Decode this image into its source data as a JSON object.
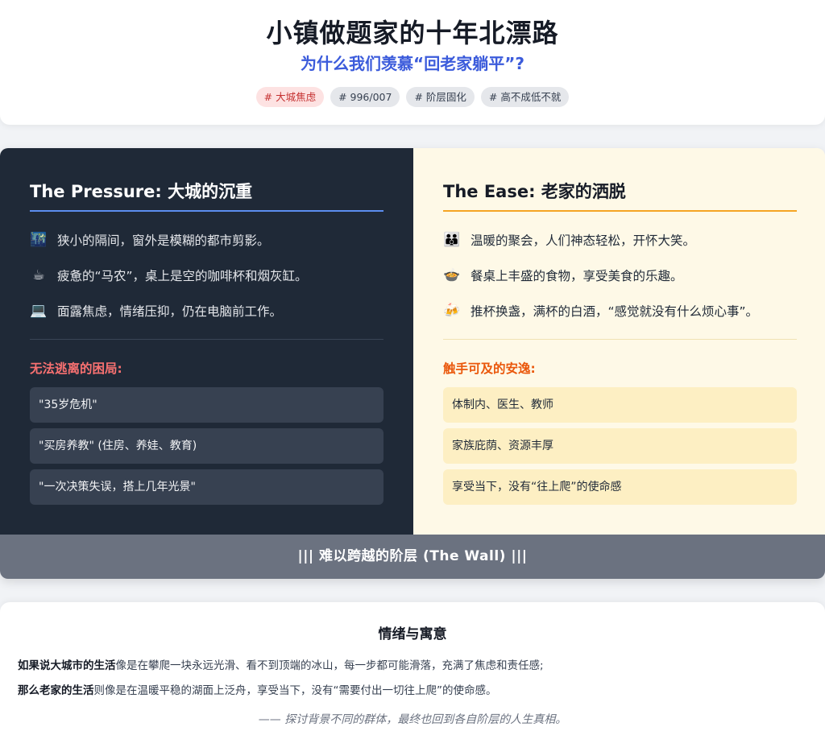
{
  "header": {
    "title": "小镇做题家的十年北漂路",
    "subtitle": "为什么我们羡慕“回老家躺平”?",
    "tags": [
      {
        "label": "# 大城焦虑",
        "highlight": true
      },
      {
        "label": "# 996/007",
        "highlight": false
      },
      {
        "label": "# 阶层固化",
        "highlight": false
      },
      {
        "label": "# 高不成低不就",
        "highlight": false
      }
    ]
  },
  "pressure": {
    "title": "The Pressure: 大城的沉重",
    "items": [
      {
        "icon": "🌃",
        "icon_name": "city-night-icon",
        "text": "狭小的隔间，窗外是模糊的都市剪影。"
      },
      {
        "icon": "☕",
        "icon_name": "coffee-icon",
        "text": "疲惫的“马农”，桌上是空的咖啡杯和烟灰缸。"
      },
      {
        "icon": "💻",
        "icon_name": "laptop-icon",
        "text": "面露焦虑，情绪压抑，仍在电脑前工作。"
      }
    ],
    "section_label": "无法逃离的困局:",
    "boxes": [
      "\"35岁危机\"",
      "\"买房养教\" (住房、养娃、教育)",
      "\"一次决策失误，搭上几年光景\""
    ]
  },
  "ease": {
    "title": "The Ease: 老家的洒脱",
    "items": [
      {
        "icon": "👪",
        "icon_name": "family-icon",
        "text": "温暖的聚会，人们神态轻松，开怀大笑。"
      },
      {
        "icon": "🍲",
        "icon_name": "food-bowl-icon",
        "text": "餐桌上丰盛的食物，享受美食的乐趣。"
      },
      {
        "icon": "🍻",
        "icon_name": "toast-drinks-icon",
        "text": "推杯换盏，满杯的白酒，“感觉就没有什么烦心事”。"
      }
    ],
    "section_label": "触手可及的安逸:",
    "boxes": [
      "体制内、医生、教师",
      "家族庇荫、资源丰厚",
      "享受当下，没有“往上爬”的使命感"
    ]
  },
  "wall": {
    "label": "||| 难以跨越的阶层 (The Wall) |||"
  },
  "footer": {
    "title": "情绪与寓意",
    "line1_bold": "如果说大城市的生活",
    "line1_rest": "像是在攀爬一块永远光滑、看不到顶端的冰山，每一步都可能滑落，充满了焦虑和责任感;",
    "line2_bold": "那么老家的生活",
    "line2_rest": "则像是在温暖平稳的湖面上泛舟，享受当下，没有“需要付出一切往上爬”的使命感。",
    "quote": "—— 探讨背景不同的群体，最终也回到各自阶层的人生真相。"
  },
  "colors": {
    "accent_blue": "#3b5bdb",
    "left_bg": "#1f2937",
    "right_bg": "#fef9e7",
    "left_underline": "#5b8def",
    "right_underline": "#f5a524",
    "left_label": "#f87171",
    "right_label": "#ea580c",
    "wall_bg": "#6b7280"
  }
}
